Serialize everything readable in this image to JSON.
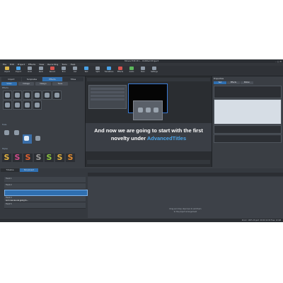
{
  "window": {
    "title": "Movie Edit Pro – Untitled Project"
  },
  "menu": [
    "File",
    "Edit",
    "Project",
    "Effects",
    "View",
    "Recording",
    "Tools",
    "Help"
  ],
  "toolbar": {
    "items": [
      {
        "label": "Import",
        "color": "#d9b44a"
      },
      {
        "label": "Export",
        "color": "#4aa3e8"
      },
      {
        "label": "Undo",
        "color": "#8e9aa7"
      },
      {
        "label": "Redo",
        "color": "#8e9aa7"
      },
      {
        "label": "Record",
        "color": "#d9534f"
      },
      {
        "label": "Trim",
        "color": "#8e9aa7"
      },
      {
        "label": "Cut",
        "color": "#8e9aa7"
      },
      {
        "label": "Text",
        "color": "#4aa3e8"
      },
      {
        "label": "Split",
        "color": "#8e9aa7"
      },
      {
        "label": "Transitions",
        "color": "#4aa3e8"
      },
      {
        "label": "Effects",
        "color": "#d9534f"
      },
      {
        "label": "Audio",
        "color": "#5cb85c"
      },
      {
        "label": "Burn",
        "color": "#8e9aa7"
      },
      {
        "label": "Settings",
        "color": "#8e9aa7"
      }
    ]
  },
  "left_panel": {
    "tabs": [
      "Import",
      "Templates",
      "Effects",
      "Titles"
    ],
    "subtabs": [
      "Video",
      "Collage",
      "Design",
      "Tools"
    ],
    "section_effects": "Effects",
    "section_tools": "Tools",
    "section_styles": "Styles",
    "style_thumbs": [
      {
        "glyph": "S",
        "color": "#e0b040"
      },
      {
        "glyph": "S",
        "color": "#d04a8a"
      },
      {
        "glyph": "S",
        "color": "#e06030"
      },
      {
        "glyph": "S",
        "color": "#9a9a9a"
      },
      {
        "glyph": "S",
        "color": "#8cc63f"
      },
      {
        "glyph": "S",
        "color": "#e0b040"
      },
      {
        "glyph": "S",
        "color": "#e08a30"
      }
    ]
  },
  "preview": {
    "subtitle_line1": "And now we are going to start with the first",
    "subtitle_line2_prefix": "novelty under ",
    "subtitle_line2_highlight": "AdvancedTitles"
  },
  "right_panel": {
    "heading": "Properties",
    "tabs": [
      "Text",
      "Effects",
      "Motion"
    ]
  },
  "timeline": {
    "tabs": [
      "Timeline",
      "Storyboard"
    ],
    "tracks": [
      "Track 1",
      "Track 2",
      "Track 3 – Title text",
      "Track 4",
      "Track 5"
    ],
    "clip_label": "And now we are going to...",
    "empty_msg_1": "Drag and drop clips here to add them",
    "empty_msg_2": "to the project arrangement"
  },
  "status": {
    "text": "Zoom: 100%   Project: 00:00:12:00   Free: 12 GB"
  }
}
